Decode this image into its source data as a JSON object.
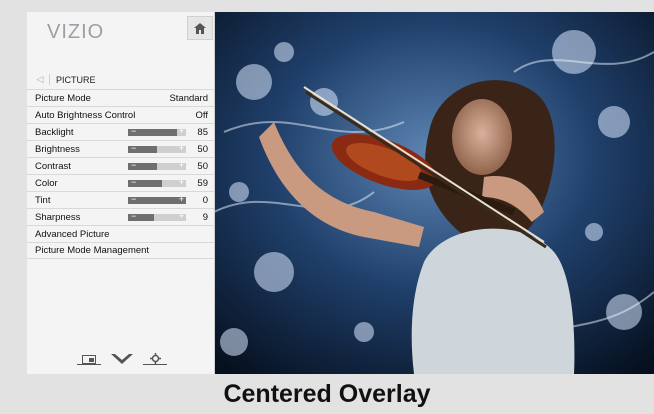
{
  "brand": {
    "logo": "VIZIO"
  },
  "breadcrumb": {
    "back_glyph": "◁",
    "title": "PICTURE"
  },
  "menu": [
    {
      "label": "Picture Mode",
      "value": "Standard",
      "type": "value"
    },
    {
      "label": "Auto Brightness Control",
      "value": "Off",
      "type": "value"
    },
    {
      "label": "Backlight",
      "value": "85",
      "level": 0.85,
      "type": "slider"
    },
    {
      "label": "Brightness",
      "value": "50",
      "level": 0.5,
      "type": "slider"
    },
    {
      "label": "Contrast",
      "value": "50",
      "level": 0.5,
      "type": "slider"
    },
    {
      "label": "Color",
      "value": "59",
      "level": 0.59,
      "type": "slider"
    },
    {
      "label": "Tint",
      "value": "0",
      "level": 1.0,
      "type": "slider"
    },
    {
      "label": "Sharpness",
      "value": "9",
      "level": 0.45,
      "type": "slider"
    },
    {
      "label": "Advanced Picture",
      "type": "link"
    },
    {
      "label": "Picture Mode Management",
      "type": "link"
    }
  ],
  "slider_signs": {
    "minus": "−",
    "plus": "+"
  },
  "caption": "Centered Overlay",
  "colors": {
    "accent": "#6f6f6f",
    "panel": "#f4f4f4"
  },
  "icons": [
    "home-icon",
    "input-icon",
    "wide-icon",
    "settings-gear-icon"
  ]
}
